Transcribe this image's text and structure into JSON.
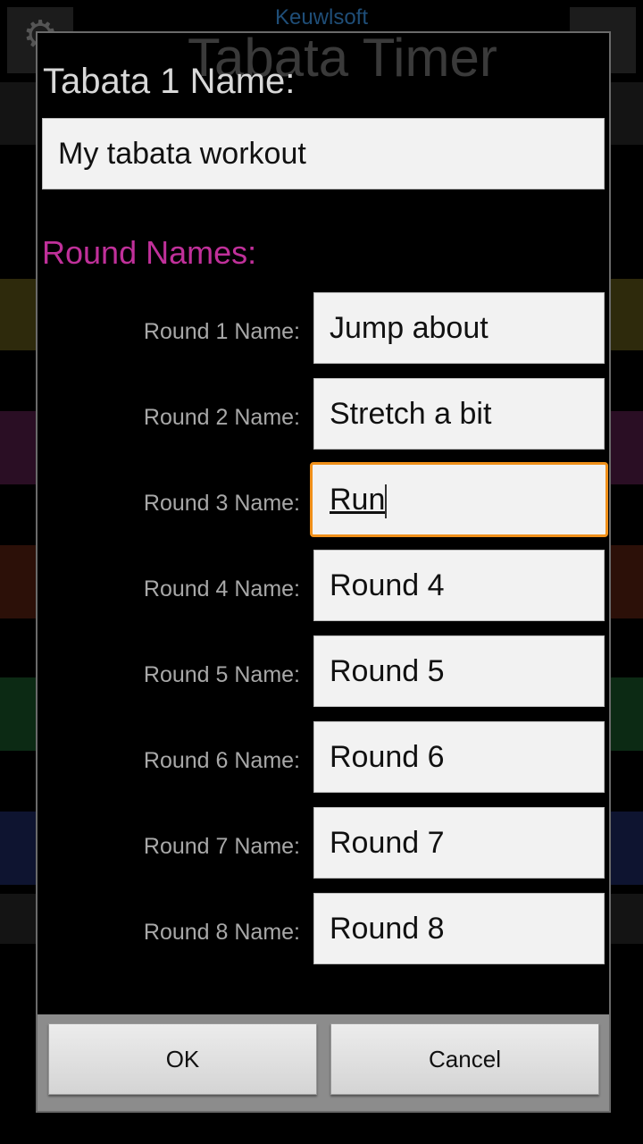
{
  "app": {
    "brand": "Keuwlsoft",
    "title": "Tabata Timer",
    "background_bands": [
      "#2e2a0c",
      "#2a0e24",
      "#2c1008",
      "#0c2a14",
      "#0e1430"
    ]
  },
  "dialog": {
    "title": "Tabata 1 Name:",
    "tabata_name": "My tabata workout",
    "round_names_heading": "Round Names:",
    "heading_color": "#c0309a",
    "focus_color": "#f0901a",
    "rounds": [
      {
        "label": "Round 1 Name:",
        "value": "Jump about"
      },
      {
        "label": "Round 2 Name:",
        "value": "Stretch a bit"
      },
      {
        "label": "Round 3 Name:",
        "value": "Run",
        "focused": true
      },
      {
        "label": "Round 4 Name:",
        "value": "Round 4"
      },
      {
        "label": "Round 5 Name:",
        "value": "Round 5"
      },
      {
        "label": "Round 6 Name:",
        "value": "Round 6"
      },
      {
        "label": "Round 7 Name:",
        "value": "Round 7"
      },
      {
        "label": "Round 8 Name:",
        "value": "Round 8"
      }
    ],
    "ok_label": "OK",
    "cancel_label": "Cancel"
  }
}
